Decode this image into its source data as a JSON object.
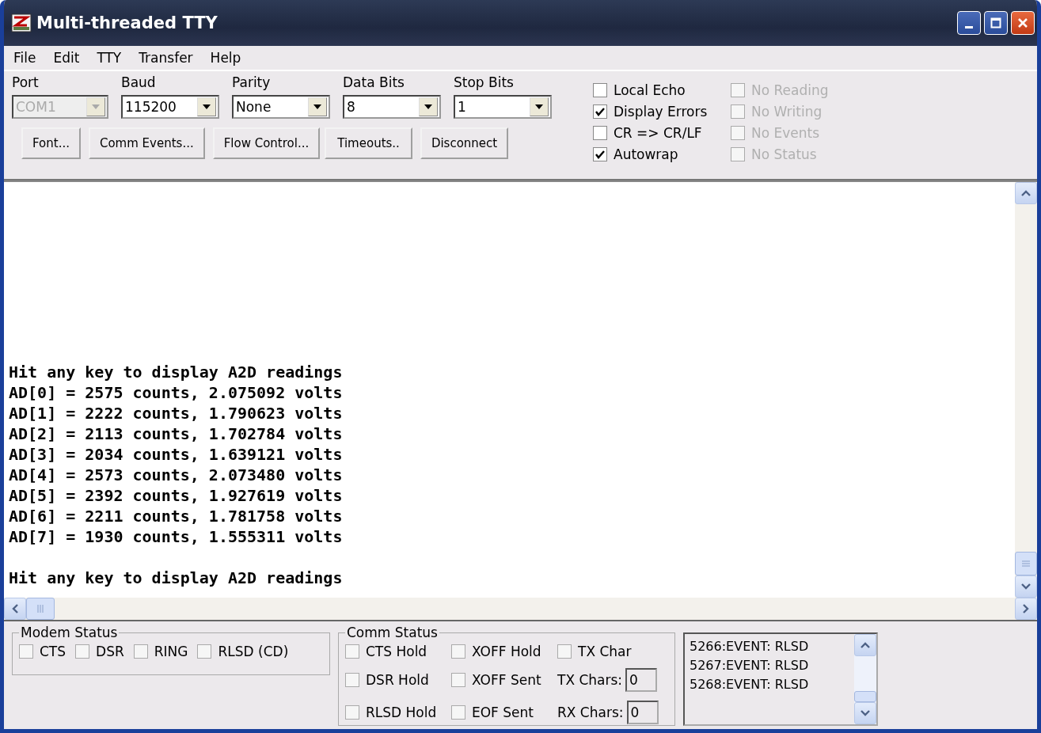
{
  "window": {
    "title": "Multi-threaded TTY"
  },
  "menu": [
    "File",
    "Edit",
    "TTY",
    "Transfer",
    "Help"
  ],
  "settings": [
    {
      "label": "Port",
      "value": "COM1",
      "disabled": true
    },
    {
      "label": "Baud",
      "value": "115200",
      "disabled": false
    },
    {
      "label": "Parity",
      "value": "None",
      "disabled": false
    },
    {
      "label": "Data Bits",
      "value": "8",
      "disabled": false
    },
    {
      "label": "Stop Bits",
      "value": "1",
      "disabled": false
    }
  ],
  "buttons": [
    "Font...",
    "Comm Events...",
    "Flow Control...",
    "Timeouts..",
    "Disconnect"
  ],
  "options": [
    {
      "label": "Local Echo",
      "checked": false,
      "disabled": false
    },
    {
      "label": "Display Errors",
      "checked": true,
      "disabled": false
    },
    {
      "label": "CR => CR/LF",
      "checked": false,
      "disabled": false
    },
    {
      "label": "Autowrap",
      "checked": true,
      "disabled": false
    }
  ],
  "flags": [
    {
      "label": "No Reading",
      "checked": false,
      "disabled": true
    },
    {
      "label": "No Writing",
      "checked": false,
      "disabled": true
    },
    {
      "label": "No Events",
      "checked": false,
      "disabled": true
    },
    {
      "label": "No Status",
      "checked": false,
      "disabled": true
    }
  ],
  "terminal": {
    "blocks": [
      [
        "Hit any key to display A2D readings",
        "AD[0] = 2575 counts, 2.075092 volts",
        "AD[1] = 2222 counts, 1.790623 volts",
        "AD[2] = 2113 counts, 1.702784 volts",
        "AD[3] = 2034 counts, 1.639121 volts",
        "AD[4] = 2573 counts, 2.073480 volts",
        "AD[5] = 2392 counts, 1.927619 volts",
        "AD[6] = 2211 counts, 1.781758 volts",
        "AD[7] = 1930 counts, 1.555311 volts"
      ],
      [
        "Hit any key to display A2D readings"
      ]
    ]
  },
  "modem_status": {
    "title": "Modem Status",
    "items": [
      {
        "label": "CTS",
        "checked": false
      },
      {
        "label": "DSR",
        "checked": false
      },
      {
        "label": "RING",
        "checked": false
      },
      {
        "label": "RLSD (CD)",
        "checked": false
      }
    ]
  },
  "comm_status": {
    "title": "Comm Status",
    "items": [
      {
        "kind": "checkbox",
        "label": "CTS Hold",
        "checked": false
      },
      {
        "kind": "checkbox",
        "label": "XOFF Hold",
        "checked": false
      },
      {
        "kind": "checkbox",
        "label": "TX Char",
        "checked": false
      },
      {
        "kind": "checkbox",
        "label": "DSR Hold",
        "checked": false
      },
      {
        "kind": "checkbox",
        "label": "XOFF Sent",
        "checked": false
      },
      {
        "kind": "field",
        "label": "TX Chars:",
        "value": "0"
      },
      {
        "kind": "checkbox",
        "label": "RLSD Hold",
        "checked": false
      },
      {
        "kind": "checkbox",
        "label": "EOF Sent",
        "checked": false
      },
      {
        "kind": "field",
        "label": "RX Chars:",
        "value": "0"
      }
    ]
  },
  "event_log": [
    "5266:EVENT: RLSD",
    "5267:EVENT: RLSD",
    "5268:EVENT: RLSD"
  ]
}
